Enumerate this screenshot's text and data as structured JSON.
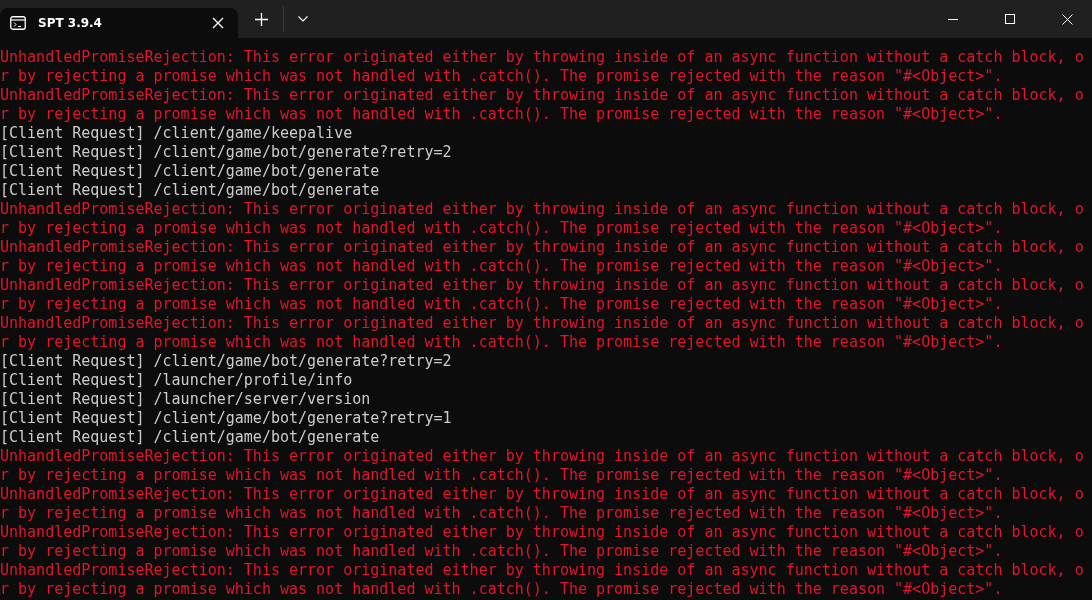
{
  "window": {
    "tab_title": "SPT 3.9.4"
  },
  "lines": [
    {
      "kind": "error",
      "text": "UnhandledPromiseRejection: This error originated either by throwing inside of an async function without a catch block, o"
    },
    {
      "kind": "error",
      "text": "r by rejecting a promise which was not handled with .catch(). The promise rejected with the reason \"#<Object>\"."
    },
    {
      "kind": "error",
      "text": "UnhandledPromiseRejection: This error originated either by throwing inside of an async function without a catch block, o"
    },
    {
      "kind": "error",
      "text": "r by rejecting a promise which was not handled with .catch(). The promise rejected with the reason \"#<Object>\"."
    },
    {
      "kind": "info",
      "text": "[Client Request] /client/game/keepalive"
    },
    {
      "kind": "info",
      "text": "[Client Request] /client/game/bot/generate?retry=2"
    },
    {
      "kind": "info",
      "text": "[Client Request] /client/game/bot/generate"
    },
    {
      "kind": "info",
      "text": "[Client Request] /client/game/bot/generate"
    },
    {
      "kind": "error",
      "text": "UnhandledPromiseRejection: This error originated either by throwing inside of an async function without a catch block, o"
    },
    {
      "kind": "error",
      "text": "r by rejecting a promise which was not handled with .catch(). The promise rejected with the reason \"#<Object>\"."
    },
    {
      "kind": "error",
      "text": "UnhandledPromiseRejection: This error originated either by throwing inside of an async function without a catch block, o"
    },
    {
      "kind": "error",
      "text": "r by rejecting a promise which was not handled with .catch(). The promise rejected with the reason \"#<Object>\"."
    },
    {
      "kind": "error",
      "text": "UnhandledPromiseRejection: This error originated either by throwing inside of an async function without a catch block, o"
    },
    {
      "kind": "error",
      "text": "r by rejecting a promise which was not handled with .catch(). The promise rejected with the reason \"#<Object>\"."
    },
    {
      "kind": "error",
      "text": "UnhandledPromiseRejection: This error originated either by throwing inside of an async function without a catch block, o"
    },
    {
      "kind": "error",
      "text": "r by rejecting a promise which was not handled with .catch(). The promise rejected with the reason \"#<Object>\"."
    },
    {
      "kind": "info",
      "text": "[Client Request] /client/game/bot/generate?retry=2"
    },
    {
      "kind": "info",
      "text": "[Client Request] /launcher/profile/info"
    },
    {
      "kind": "info",
      "text": "[Client Request] /launcher/server/version"
    },
    {
      "kind": "info",
      "text": "[Client Request] /client/game/bot/generate?retry=1"
    },
    {
      "kind": "info",
      "text": "[Client Request] /client/game/bot/generate"
    },
    {
      "kind": "error",
      "text": "UnhandledPromiseRejection: This error originated either by throwing inside of an async function without a catch block, o"
    },
    {
      "kind": "error",
      "text": "r by rejecting a promise which was not handled with .catch(). The promise rejected with the reason \"#<Object>\"."
    },
    {
      "kind": "error",
      "text": "UnhandledPromiseRejection: This error originated either by throwing inside of an async function without a catch block, o"
    },
    {
      "kind": "error",
      "text": "r by rejecting a promise which was not handled with .catch(). The promise rejected with the reason \"#<Object>\"."
    },
    {
      "kind": "error",
      "text": "UnhandledPromiseRejection: This error originated either by throwing inside of an async function without a catch block, o"
    },
    {
      "kind": "error",
      "text": "r by rejecting a promise which was not handled with .catch(). The promise rejected with the reason \"#<Object>\"."
    },
    {
      "kind": "error",
      "text": "UnhandledPromiseRejection: This error originated either by throwing inside of an async function without a catch block, o"
    },
    {
      "kind": "error",
      "text": "r by rejecting a promise which was not handled with .catch(). The promise rejected with the reason \"#<Object>\"."
    }
  ]
}
